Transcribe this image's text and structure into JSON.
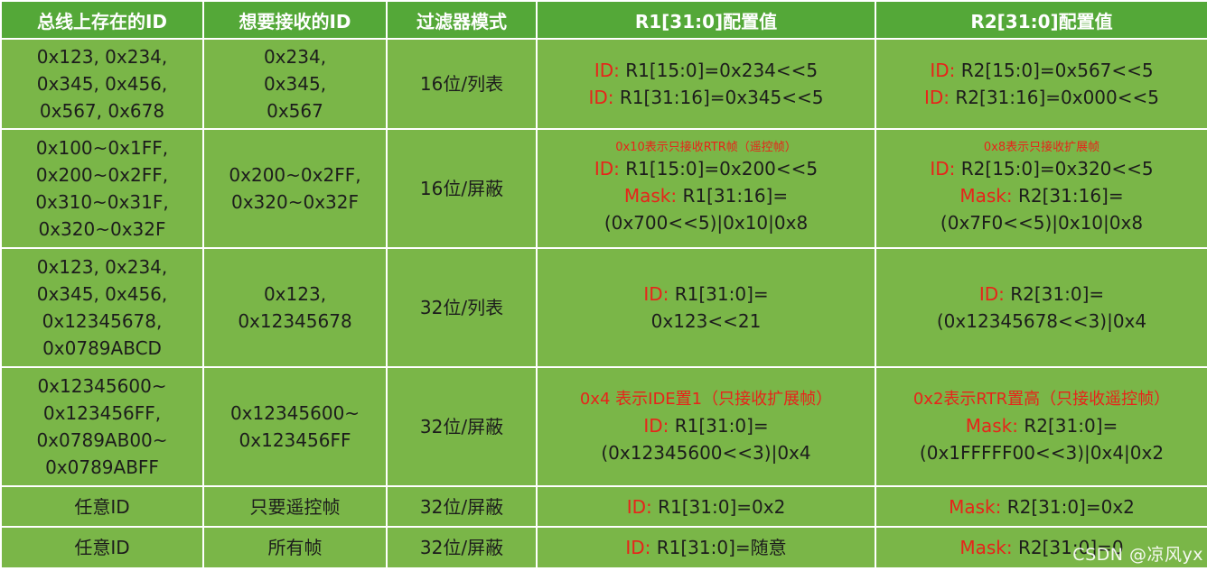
{
  "header": {
    "col1": "总线上存在的ID",
    "col2": "想要接收的ID",
    "col3": "过滤器模式",
    "col4": "R1[31:0]配置值",
    "col5": "R2[31:0]配置值"
  },
  "rows": [
    {
      "c1": [
        "0x123, 0x234,",
        "0x345, 0x456,",
        "0x567, 0x678"
      ],
      "c2": [
        "0x234,",
        "0x345,",
        "0x567"
      ],
      "c3": "16位/列表",
      "c4": {
        "l1_tag": "ID:",
        "l1": " R1[15:0]=0x234<<5",
        "l2_tag": "ID:",
        "l2": " R1[31:16]=0x345<<5"
      },
      "c5": {
        "l1_tag": "ID:",
        "l1": " R2[15:0]=0x567<<5",
        "l2_tag": "ID:",
        "l2": " R2[31:16]=0x000<<5"
      }
    },
    {
      "c1": [
        "0x100~0x1FF,",
        "0x200~0x2FF,",
        "0x310~0x31F,",
        "0x320~0x32F"
      ],
      "c2": [
        "0x200~0x2FF,",
        "0x320~0x32F"
      ],
      "c3": "16位/屏蔽",
      "c4": {
        "note": "0x10表示只接收RTR帧（遥控帧）",
        "l1_tag": "ID:",
        "l1": " R1[15:0]=0x200<<5",
        "l2_tag": "Mask:",
        "l2": " R1[31:16]=",
        "l3": "(0x700<<5)|0x10|0x8"
      },
      "c5": {
        "note": "0x8表示只接收扩展帧",
        "l1_tag": "ID:",
        "l1": " R2[15:0]=0x320<<5",
        "l2_tag": "Mask:",
        "l2": " R2[31:16]=",
        "l3": "(0x7F0<<5)|0x10|0x8"
      }
    },
    {
      "c1": [
        "0x123, 0x234,",
        "0x345, 0x456,",
        "0x12345678,",
        "0x0789ABCD"
      ],
      "c2": [
        "0x123,",
        "0x12345678"
      ],
      "c3": "32位/列表",
      "c4": {
        "l1_tag": "ID:",
        "l1": " R1[31:0]=",
        "l2": "0x123<<21"
      },
      "c5": {
        "l1_tag": "ID:",
        "l1": " R2[31:0]=",
        "l2": "(0x12345678<<3)|0x4"
      }
    },
    {
      "c1": [
        "0x12345600~",
        "0x123456FF,",
        "0x0789AB00~",
        "0x0789ABFF"
      ],
      "c2": [
        "0x12345600~",
        "0x123456FF"
      ],
      "c3": "32位/屏蔽",
      "c4": {
        "note": "0x4 表示IDE置1（只接收扩展帧）",
        "l1_tag": "ID:",
        "l1": " R1[31:0]=",
        "l2": "(0x12345600<<3)|0x4"
      },
      "c5": {
        "note": "0x2表示RTR置高（只接收遥控帧）",
        "l1_tag": "Mask:",
        "l1": " R2[31:0]=",
        "l2": "(0x1FFFFF00<<3)|0x4|0x2"
      }
    },
    {
      "c1": "任意ID",
      "c2": "只要遥控帧",
      "c3": "32位/屏蔽",
      "c4": {
        "l1_tag": "ID:",
        "l1": " R1[31:0]=0x2"
      },
      "c5": {
        "l1_tag": "Mask:",
        "l1": " R2[31:0]=0x2"
      }
    },
    {
      "c1": "任意ID",
      "c2": "所有帧",
      "c3": "32位/屏蔽",
      "c4": {
        "l1_tag": "ID:",
        "l1": " R1[31:0]=随意"
      },
      "c5": {
        "l1_tag": "Mask:",
        "l1": " R2[31:0]=0"
      }
    }
  ],
  "watermark": "CSDN @凉风yx"
}
